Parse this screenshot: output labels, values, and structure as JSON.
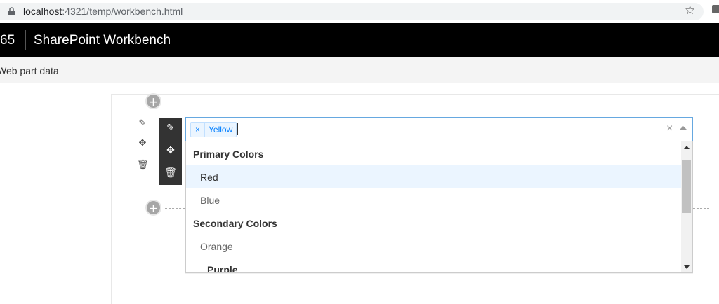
{
  "browser": {
    "url_host": "localhost",
    "url_rest": ":4321/temp/workbench.html"
  },
  "header": {
    "suite": "65",
    "title": "SharePoint Workbench"
  },
  "commandbar": {
    "web_part_data": "Web part data"
  },
  "select": {
    "tags": [
      "Yellow"
    ],
    "tag_remove": "×",
    "clear": "×"
  },
  "menu": {
    "options": [
      {
        "label": "Primary Colors",
        "type": "group"
      },
      {
        "label": "Red",
        "type": "option",
        "focused": true
      },
      {
        "label": "Blue",
        "type": "option"
      },
      {
        "label": "Secondary Colors",
        "type": "group"
      },
      {
        "label": "Orange",
        "type": "option"
      },
      {
        "label": "Purple",
        "type": "option"
      }
    ]
  }
}
